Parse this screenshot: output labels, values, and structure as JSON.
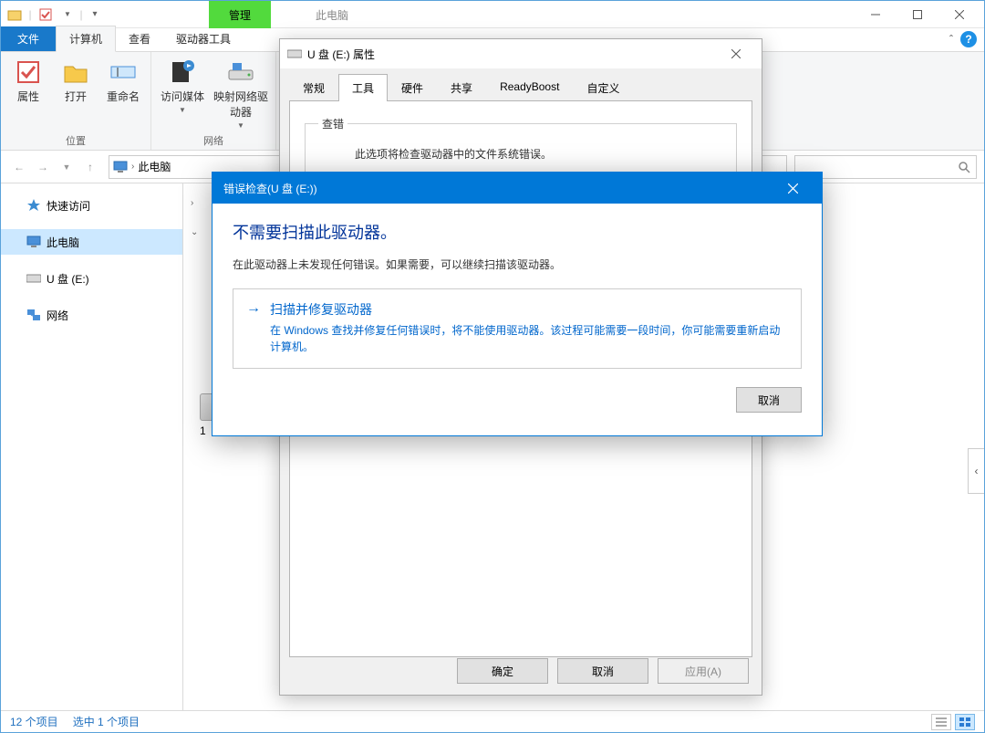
{
  "titlebar": {
    "manage": "管理",
    "windowTitle": "此电脑"
  },
  "ribbonTabs": {
    "file": "文件",
    "computer": "计算机",
    "view": "查看",
    "driveTools": "驱动器工具"
  },
  "ribbon": {
    "group1": {
      "properties": "属性",
      "open": "打开",
      "rename": "重命名",
      "label": "位置"
    },
    "group2": {
      "accessMedia": "访问媒体",
      "mapNetworkDrive": "映射网络驱动器",
      "dropdown": "▾",
      "label": "网络"
    }
  },
  "address": {
    "root": "此电脑"
  },
  "navPane": {
    "quickAccess": "快速访问",
    "thisPC": "此电脑",
    "usb": "U 盘 (E:)",
    "network": "网络"
  },
  "content": {
    "driveLetter": "1"
  },
  "statusbar": {
    "count": "12 个项目",
    "selected": "选中 1 个项目"
  },
  "props": {
    "title": "U 盘 (E:) 属性",
    "tabs": {
      "general": "常规",
      "tools": "工具",
      "hardware": "硬件",
      "sharing": "共享",
      "readyboost": "ReadyBoost",
      "custom": "自定义"
    },
    "check": {
      "legend": "查错",
      "desc": "此选项将检查驱动器中的文件系统错误。"
    },
    "buttons": {
      "ok": "确定",
      "cancel": "取消",
      "apply": "应用(A)"
    }
  },
  "errdlg": {
    "title": "错误检查(U 盘 (E:))",
    "heading": "不需要扫描此驱动器。",
    "sub": "在此驱动器上未发现任何错误。如果需要，可以继续扫描该驱动器。",
    "action": {
      "title": "扫描并修复驱动器",
      "desc": "在 Windows 查找并修复任何错误时，将不能使用驱动器。该过程可能需要一段时间，你可能需要重新启动计算机。"
    },
    "cancel": "取消"
  }
}
